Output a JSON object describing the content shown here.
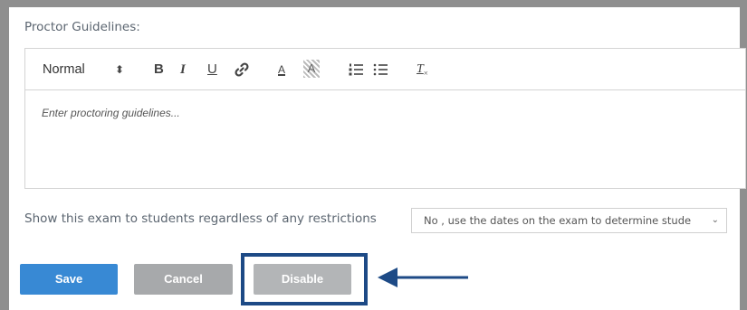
{
  "proctor": {
    "label": "Proctor Guidelines:",
    "toolbar": {
      "format_select": "Normal",
      "format_arrows": "⬍",
      "bold": "B",
      "italic": "I",
      "underline": "U",
      "font_color": "A",
      "background_color": "A",
      "clean_format": "T"
    },
    "placeholder": "Enter proctoring guidelines..."
  },
  "restrictions": {
    "label": "Show this exam to students regardless of any restrictions",
    "selected_value": "No , use the dates on the exam to determine stude",
    "chevron": "⌄"
  },
  "buttons": {
    "save": "Save",
    "cancel": "Cancel",
    "disable": "Disable"
  },
  "colors": {
    "save_bg": "#3889d4",
    "cancel_bg": "#a7a9ab",
    "disable_bg": "#b3b5b7",
    "highlight": "#1d4a86"
  }
}
